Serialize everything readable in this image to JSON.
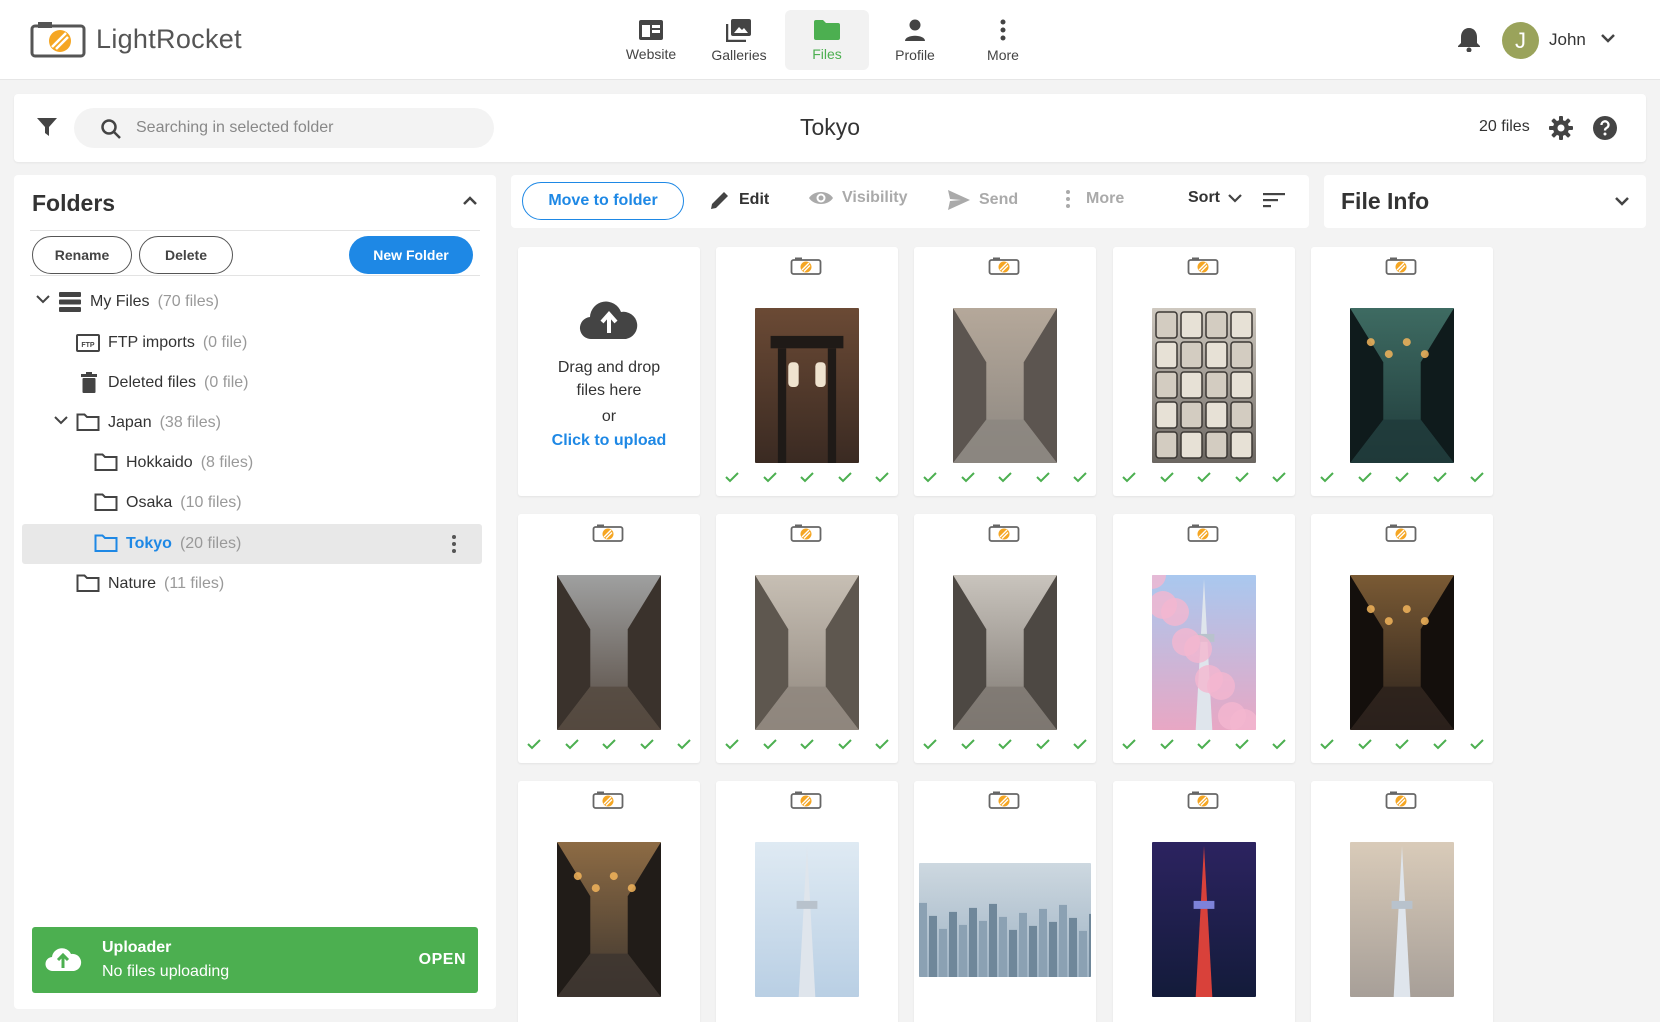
{
  "app": {
    "logo_text": "LightRocket"
  },
  "nav": {
    "items": [
      {
        "label": "Website",
        "icon": "website-icon",
        "active": false
      },
      {
        "label": "Galleries",
        "icon": "galleries-icon",
        "active": false
      },
      {
        "label": "Files",
        "icon": "folder-icon",
        "active": true
      },
      {
        "label": "Profile",
        "icon": "profile-icon",
        "active": false
      },
      {
        "label": "More",
        "icon": "more-vertical-icon",
        "active": false
      }
    ]
  },
  "user": {
    "initial": "J",
    "name": "John"
  },
  "search": {
    "placeholder": "Searching in selected folder"
  },
  "header": {
    "folder_title": "Tokyo",
    "files_count": "20 files"
  },
  "folders": {
    "title": "Folders",
    "rename_label": "Rename",
    "delete_label": "Delete",
    "new_folder_label": "New Folder",
    "tree": [
      {
        "name": "My Files",
        "count": "(70 files)",
        "icon": "storage-icon",
        "expanded": true,
        "selected": false
      },
      {
        "name": "FTP imports",
        "count": "(0 file)",
        "icon": "ftp-icon",
        "selected": false
      },
      {
        "name": "Deleted files",
        "count": "(0 file)",
        "icon": "trash-icon",
        "selected": false
      },
      {
        "name": "Japan",
        "count": "(38 files)",
        "icon": "folder-icon",
        "expanded": true,
        "selected": false
      },
      {
        "name": "Hokkaido",
        "count": "(8 files)",
        "icon": "folder-icon",
        "selected": false
      },
      {
        "name": "Osaka",
        "count": "(10 files)",
        "icon": "folder-icon",
        "selected": false
      },
      {
        "name": "Tokyo",
        "count": "(20 files)",
        "icon": "folder-icon",
        "selected": true
      },
      {
        "name": "Nature",
        "count": "(11 files)",
        "icon": "folder-icon",
        "selected": false
      }
    ]
  },
  "uploader": {
    "title": "Uploader",
    "status": "No files uploading",
    "open_label": "OPEN"
  },
  "toolbar": {
    "move_label": "Move to folder",
    "edit_label": "Edit",
    "visibility_label": "Visibility",
    "send_label": "Send",
    "more_label": "More",
    "sort_label": "Sort"
  },
  "file_info": {
    "title": "File Info"
  },
  "upload_card": {
    "line1": "Drag and drop",
    "line2": "files here",
    "line3": "or",
    "link": "Click to upload"
  },
  "colors": {
    "accent": "#1e88e5",
    "brand_green": "#4caf50",
    "logo_orange": "#f5a623",
    "check_green": "#4caf50"
  },
  "files": [
    {
      "scene": "shrine-gate",
      "status_checks": 5
    },
    {
      "scene": "shopping-street-crossing",
      "status_checks": 5
    },
    {
      "scene": "sake-barrels",
      "status_checks": 5
    },
    {
      "scene": "night-alley-shop",
      "status_checks": 5
    },
    {
      "scene": "wooden-street",
      "status_checks": 5
    },
    {
      "scene": "narrow-alley-walkers",
      "status_checks": 5
    },
    {
      "scene": "quiet-street",
      "status_checks": 5
    },
    {
      "scene": "skytree-cherry-blossoms",
      "status_checks": 5
    },
    {
      "scene": "lantern-alley-night",
      "status_checks": 5
    },
    {
      "scene": "rainy-alley-night",
      "status_checks": 0
    },
    {
      "scene": "skytree-carp-streamers",
      "status_checks": 0
    },
    {
      "scene": "city-skyline",
      "status_checks": 0
    },
    {
      "scene": "tokyo-tower-night",
      "status_checks": 0
    },
    {
      "scene": "skyscraper-dusk",
      "status_checks": 0
    }
  ]
}
